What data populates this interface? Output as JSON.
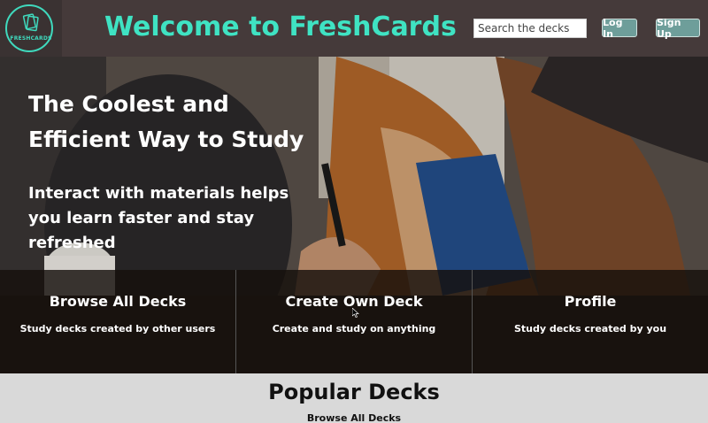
{
  "header": {
    "logo_text": "FRESHCARDS",
    "title": "Welcome to FreshCards",
    "search_placeholder": "Search the decks",
    "login_label": "Log In",
    "signup_label": "Sign Up"
  },
  "hero": {
    "headline_line1": "The Coolest and",
    "headline_line2": "Efficient Way to Study",
    "sub_line1": "Interact with materials helps",
    "sub_line2": "you learn faster and stay",
    "sub_line3": "refreshed"
  },
  "cards": [
    {
      "title": "Browse All Decks",
      "desc": "Study decks created by other users"
    },
    {
      "title": "Create Own Deck",
      "desc": "Create and study on anything"
    },
    {
      "title": "Profile",
      "desc": "Study decks created by you"
    }
  ],
  "popular": {
    "title": "Popular Decks",
    "link": "Browse All Decks"
  },
  "colors": {
    "accent": "#3fe3c3",
    "header_bg": "#453a3a",
    "button_bg": "#6e9e9a"
  }
}
